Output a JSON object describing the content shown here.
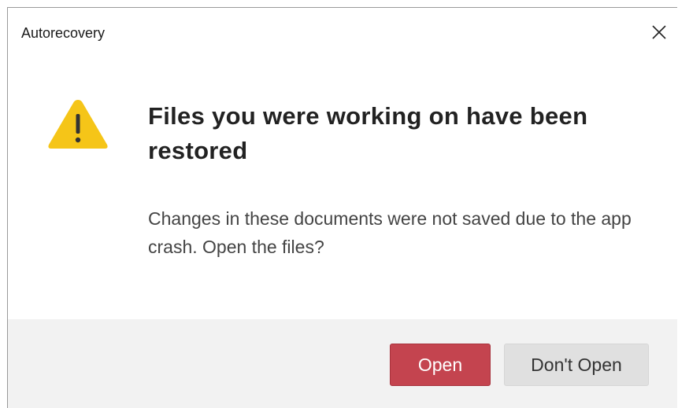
{
  "window": {
    "title": "Autorecovery",
    "close_icon": "close-icon"
  },
  "content": {
    "icon": "warning-icon",
    "icon_color": "#F5C518",
    "heading": "Files you were working on have been restored",
    "message": "Changes in these documents were not saved due to the app crash. Open the files?"
  },
  "footer": {
    "open_label": "Open",
    "dont_open_label": "Don't Open",
    "open_color": "#C4444F"
  }
}
